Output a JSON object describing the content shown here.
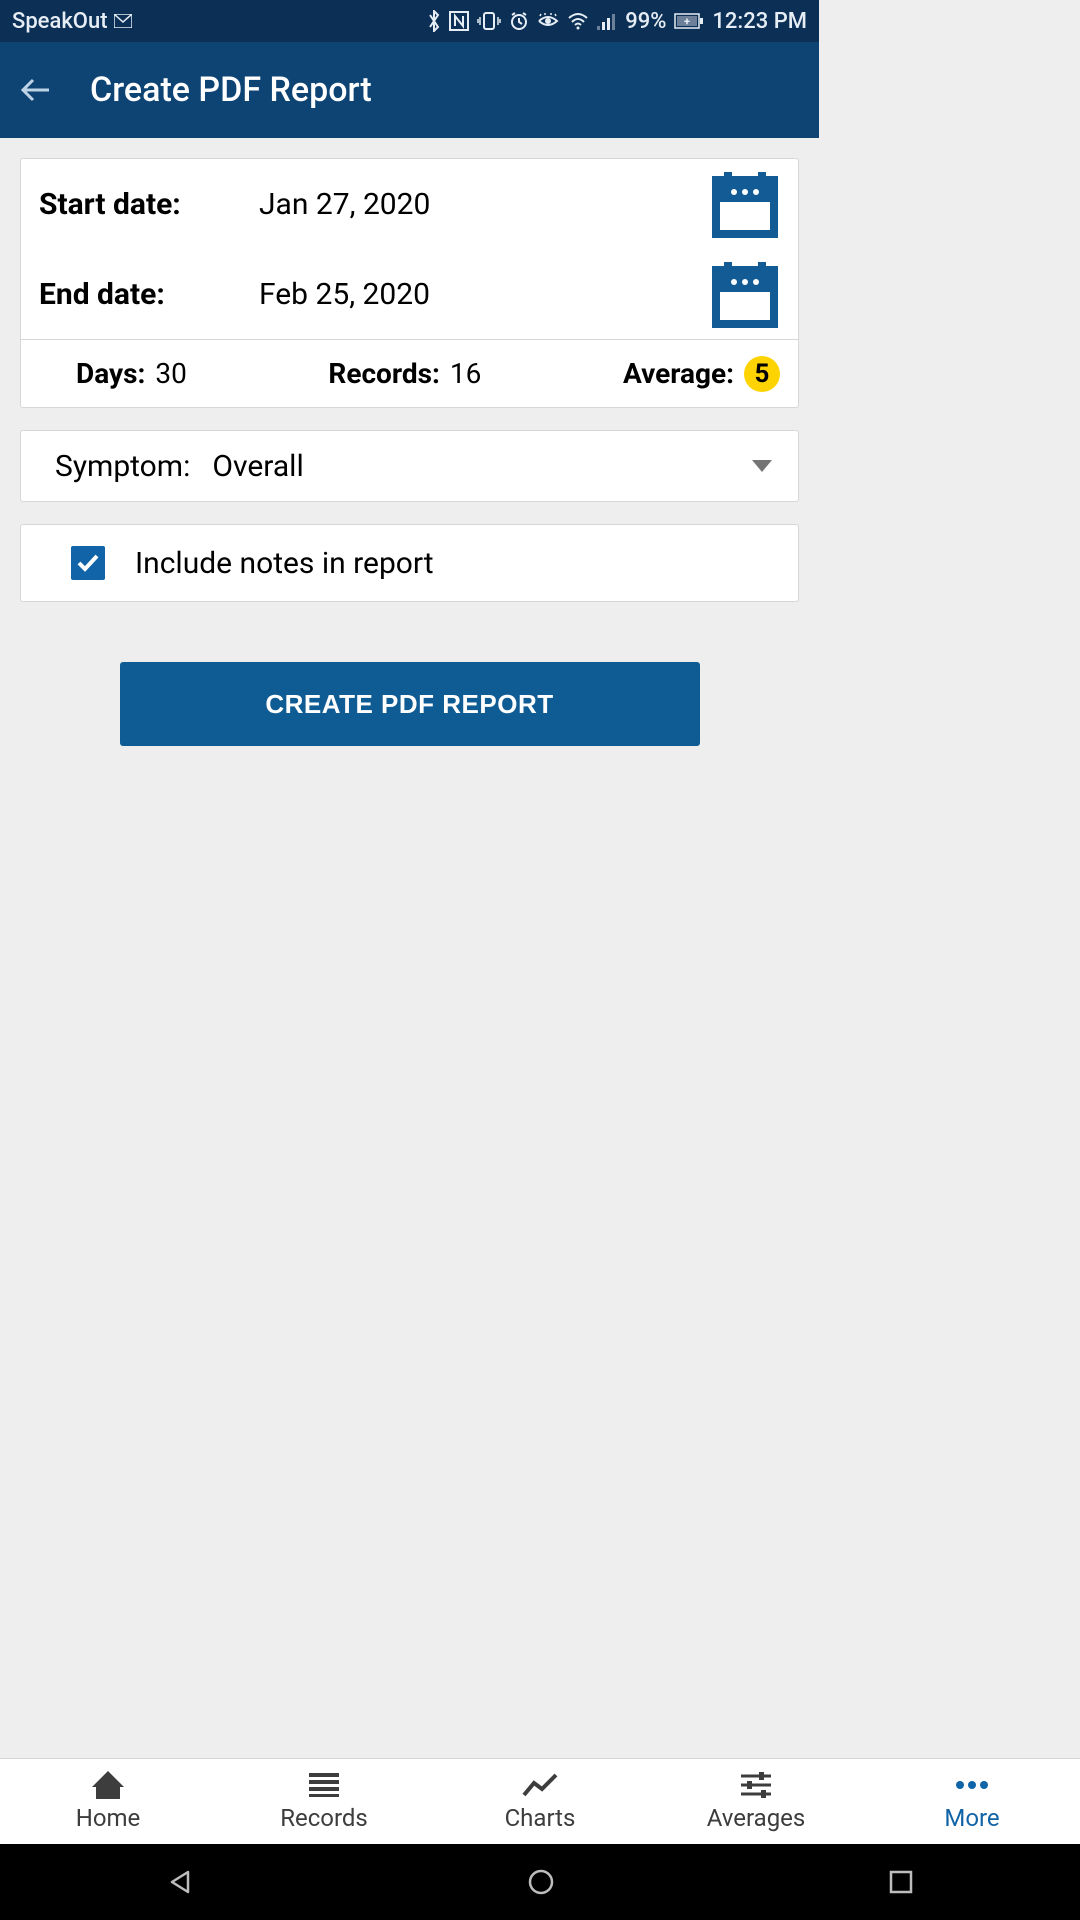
{
  "status_bar": {
    "carrier": "SpeakOut",
    "battery_percent": "99%",
    "time": "12:23 PM"
  },
  "header": {
    "title": "Create PDF Report"
  },
  "dates": {
    "start_label": "Start date:",
    "start_value": "Jan 27, 2020",
    "end_label": "End date:",
    "end_value": "Feb 25, 2020"
  },
  "stats": {
    "days_label": "Days:",
    "days_value": "30",
    "records_label": "Records:",
    "records_value": "16",
    "average_label": "Average:",
    "average_value": "5"
  },
  "symptom": {
    "label": "Symptom:",
    "value": "Overall"
  },
  "include_notes": {
    "label": "Include notes in report",
    "checked": true
  },
  "action_button": {
    "label": "CREATE PDF REPORT"
  },
  "bottom_nav": {
    "items": [
      {
        "label": "Home"
      },
      {
        "label": "Records"
      },
      {
        "label": "Charts"
      },
      {
        "label": "Averages"
      },
      {
        "label": "More"
      }
    ],
    "active_index": 4
  },
  "colors": {
    "status_bar_bg": "#0C2F55",
    "app_bar_bg": "#0E4474",
    "primary_blue": "#1064A7",
    "button_blue": "#0F5C94",
    "avg_badge_bg": "#FED302"
  }
}
